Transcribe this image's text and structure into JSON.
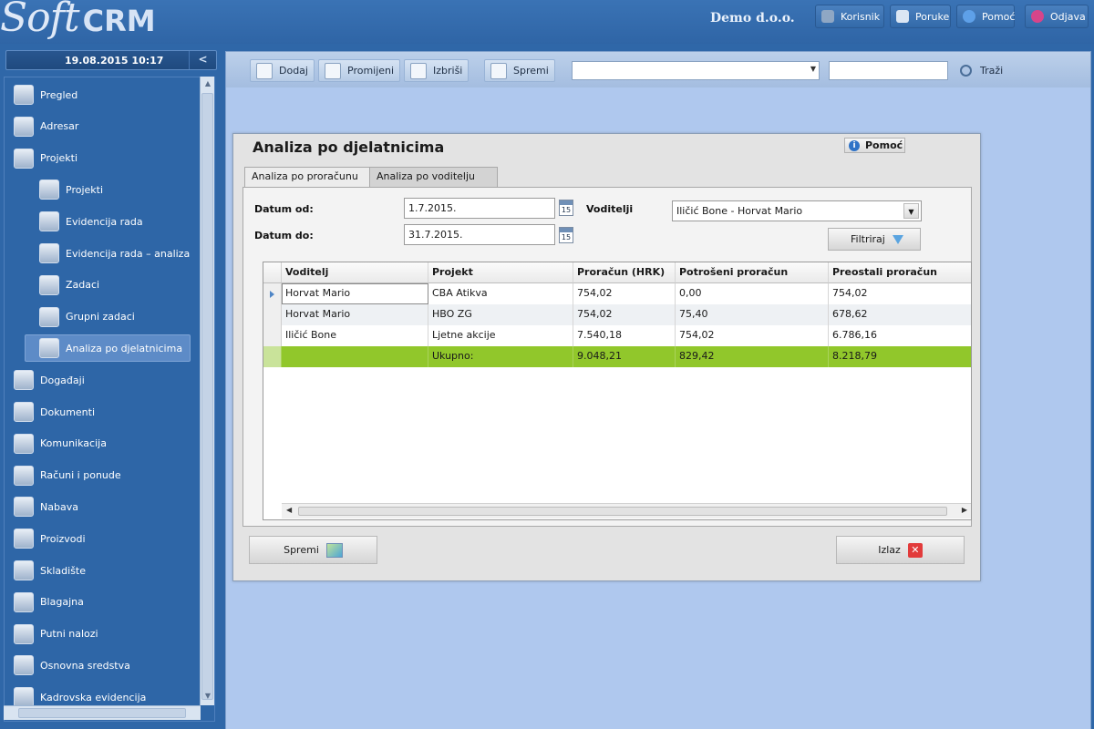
{
  "app": {
    "logo_soft": "Soft",
    "logo_crm": "CRM",
    "company": "Demo d.o.o."
  },
  "header_buttons": [
    {
      "label": "Korisnik",
      "icon": "user-icon",
      "color": "#8fa7c4"
    },
    {
      "label": "Poruke",
      "icon": "messages-icon",
      "color": "#dbe6f3"
    },
    {
      "label": "Pomoć",
      "icon": "info-icon",
      "color": "#5ea0e8"
    },
    {
      "label": "Odjava",
      "icon": "power-icon",
      "color": "#d6458a"
    }
  ],
  "sidebar": {
    "datetime": "19.08.2015 10:17",
    "collapse_glyph": "<",
    "items": [
      {
        "label": "Pregled",
        "icon": "overview-icon",
        "level": 1
      },
      {
        "label": "Adresar",
        "icon": "address-book-icon",
        "level": 1
      },
      {
        "label": "Projekti",
        "icon": "folder-icon",
        "level": 1
      },
      {
        "label": "Projekti",
        "icon": "projects-icon",
        "level": 2
      },
      {
        "label": "Evidencija rada",
        "icon": "wrench-icon",
        "level": 2
      },
      {
        "label": "Evidencija rada – analiza",
        "icon": "bar-chart-icon",
        "level": 2
      },
      {
        "label": "Zadaci",
        "icon": "gear-icon",
        "level": 2
      },
      {
        "label": "Grupni zadaci",
        "icon": "group-icon",
        "level": 2
      },
      {
        "label": "Analiza po djelatnicima",
        "icon": "analysis-icon",
        "level": 2,
        "active": true
      },
      {
        "label": "Događaji",
        "icon": "calendar-icon",
        "level": 1
      },
      {
        "label": "Dokumenti",
        "icon": "document-icon",
        "level": 1
      },
      {
        "label": "Komunikacija",
        "icon": "phone-icon",
        "level": 1
      },
      {
        "label": "Računi i ponude",
        "icon": "invoice-icon",
        "level": 1
      },
      {
        "label": "Nabava",
        "icon": "purchase-icon",
        "level": 1
      },
      {
        "label": "Proizvodi",
        "icon": "box-icon",
        "level": 1
      },
      {
        "label": "Skladište",
        "icon": "warehouse-icon",
        "level": 1
      },
      {
        "label": "Blagajna",
        "icon": "cash-icon",
        "level": 1
      },
      {
        "label": "Putni nalozi",
        "icon": "travel-icon",
        "level": 1
      },
      {
        "label": "Osnovna sredstva",
        "icon": "assets-icon",
        "level": 1
      },
      {
        "label": "Kadrovska evidencija",
        "icon": "hr-icon",
        "level": 1
      }
    ]
  },
  "toolbar": {
    "add_label": "Dodaj",
    "edit_label": "Promijeni",
    "delete_label": "Izbriši",
    "save_label": "Spremi",
    "search_label": "Traži",
    "select_value": "",
    "search_value": ""
  },
  "dialog": {
    "title": "Analiza po djelatnicima",
    "help_label": "Pomoć",
    "tabs": [
      "Analiza po proračunu",
      "Analiza po voditelju"
    ],
    "active_tab": 1,
    "date_from_label": "Datum od:",
    "date_from_value": "1.7.2015.",
    "date_to_label": "Datum do:",
    "date_to_value": "31.7.2015.",
    "calendar_day": "15",
    "managers_label": "Voditelji",
    "managers_value": "Iličić  Bone - Horvat Mario",
    "filter_label": "Filtriraj",
    "save_label": "Spremi",
    "exit_label": "Izlaz"
  },
  "grid": {
    "columns": [
      "Voditelj",
      "Projekt",
      "Proračun (HRK)",
      "Potrošeni proračun",
      "Preostali proračun"
    ],
    "rows": [
      [
        "Horvat Mario",
        "CBA Atikva",
        "754,02",
        "0,00",
        "754,02"
      ],
      [
        "Horvat Mario",
        "HBO ZG",
        "754,02",
        "75,40",
        "678,62"
      ],
      [
        "Iličić  Bone",
        "Ljetne akcije",
        "7.540,18",
        "754,02",
        "6.786,16"
      ]
    ],
    "total": [
      "",
      "Ukupno:",
      "9.048,21",
      "829,42",
      "8.218,79"
    ],
    "total_color": "#91c72b"
  }
}
